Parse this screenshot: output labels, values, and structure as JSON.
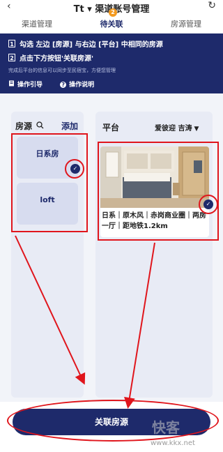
{
  "header": {
    "back_icon": "‹",
    "title": "Tt ▾ 渠道账号管理",
    "refresh_icon": "↻"
  },
  "tabs": [
    {
      "label": "渠道管理"
    },
    {
      "label": "待关联",
      "badge": "2"
    },
    {
      "label": "房源管理"
    }
  ],
  "banner": {
    "step1_num": "1",
    "step1": "勾选 左边 [房源] 与右边 [平台] 中相同的房源",
    "step2_num": "2",
    "step2": "点击下方按钮'关联房源'",
    "note": "完成后平台的信息可以同步至民宿宝，方便您管理",
    "guide_label": "操作引导",
    "help_label": "操作说明"
  },
  "left": {
    "title": "房源",
    "add_label": "添加",
    "items": [
      {
        "label": "日系房",
        "checked": true
      },
      {
        "label": "loft",
        "checked": false
      }
    ]
  },
  "right": {
    "title": "平台",
    "platform_selected": "爱彼迎 吉涛",
    "room": {
      "desc": "日系｜原木风｜赤岗商业圈｜两房一厅｜距地铁1.2km",
      "checked": true
    }
  },
  "bottom": {
    "button_label": "关联房源"
  },
  "watermark": {
    "logo_text": "快客",
    "url": "www.kkx.net"
  },
  "colors": {
    "primary": "#1e2a6b",
    "badge": "#f39a1f",
    "annotation_red": "#e0151c",
    "panel_bg": "#e8ebf5"
  }
}
